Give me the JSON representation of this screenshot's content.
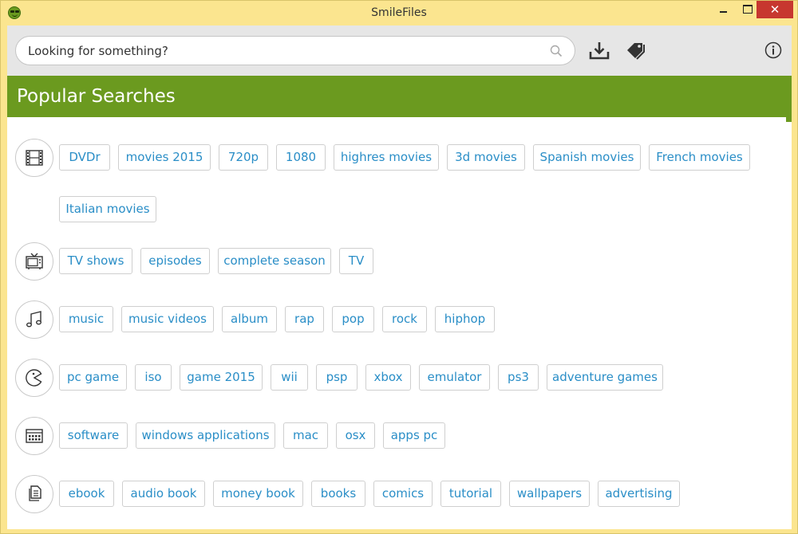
{
  "window": {
    "title": "SmileFiles",
    "close_glyph": "✕"
  },
  "toolbar": {
    "search_placeholder": "Looking for something?",
    "search_value": ""
  },
  "banner": {
    "title": "Popular Searches"
  },
  "colors": {
    "accent_green": "#6b9a1f",
    "tag_text": "#2a8ec7",
    "titlebar": "#fbe58f",
    "close": "#c7372f"
  },
  "categories": [
    {
      "icon": "film-icon",
      "tags": [
        "DVDr",
        "movies 2015",
        "720p",
        "1080",
        "highres movies",
        "3d movies",
        "Spanish movies",
        "French movies",
        "Italian movies"
      ]
    },
    {
      "icon": "tv-icon",
      "tags": [
        "TV shows",
        "episodes",
        "complete season",
        "TV"
      ]
    },
    {
      "icon": "music-note-icon",
      "tags": [
        "music",
        "music videos",
        "album",
        "rap",
        "pop",
        "rock",
        "hiphop"
      ]
    },
    {
      "icon": "pacman-icon",
      "tags": [
        "pc game",
        "iso",
        "game 2015",
        "wii",
        "psp",
        "xbox",
        "emulator",
        "ps3",
        "adventure games"
      ]
    },
    {
      "icon": "app-window-icon",
      "tags": [
        "software",
        "windows applications",
        "mac",
        "osx",
        "apps pc"
      ]
    },
    {
      "icon": "document-icon",
      "tags": [
        "ebook",
        "audio book",
        "money book",
        "books",
        "comics",
        "tutorial",
        "wallpapers",
        "advertising"
      ]
    }
  ]
}
